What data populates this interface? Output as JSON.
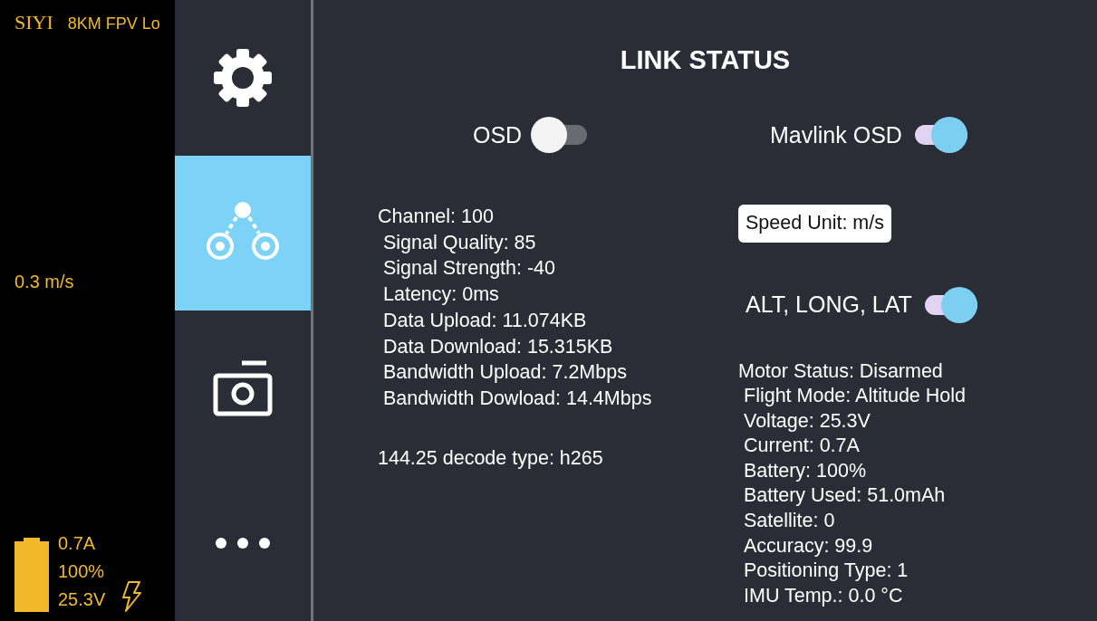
{
  "osd_overlay": {
    "brand": "SIYI",
    "title": "8KM FPV Lo",
    "speed": "0.3 m/s",
    "battery": {
      "level": 1,
      "current": "0.7A",
      "percent": "100%",
      "voltage": "25.3V"
    }
  },
  "sidebar": {
    "items": [
      {
        "kind": "gear",
        "selected": false
      },
      {
        "kind": "link",
        "selected": true
      },
      {
        "kind": "camera",
        "selected": false
      },
      {
        "kind": "more",
        "selected": false
      }
    ]
  },
  "panel": {
    "title": "LINK STATUS",
    "left": {
      "toggle": {
        "label": "OSD",
        "on": false
      },
      "stats": [
        "Channel: 100",
        "Signal Quality: 85",
        "Signal Strength: -40",
        "Latency: 0ms",
        "Data Upload: 11.074KB",
        "Data Download: 15.315KB",
        "Bandwidth Upload: 7.2Mbps",
        "Bandwidth Dowload: 14.4Mbps"
      ],
      "decode": "144.25 decode type: h265"
    },
    "right": {
      "toggle": {
        "label": "Mavlink OSD",
        "on": true
      },
      "speed_unit_button": "Speed Unit: m/s",
      "toggle2": {
        "label": "ALT, LONG, LAT",
        "on": true
      },
      "stats": [
        "Motor Status: Disarmed",
        "Flight Mode: Altitude Hold",
        "Voltage: 25.3V",
        "Current: 0.7A",
        "Battery: 100%",
        "Battery Used: 51.0mAh",
        "Satellite: 0",
        "Accuracy: 99.9",
        "Positioning Type: 1",
        "IMU Temp.: 0.0 °C"
      ]
    }
  }
}
